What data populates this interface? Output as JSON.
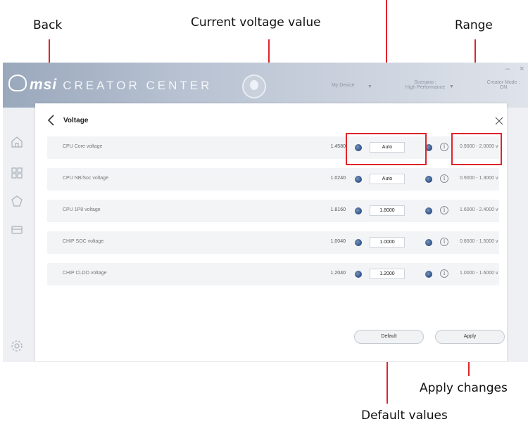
{
  "annotations": {
    "back": "Back",
    "current_voltage": "Current voltage value",
    "range": "Range",
    "apply_changes": "Apply changes",
    "default_values": "Default values"
  },
  "titlebar": {
    "brand": "msi",
    "product": "CREATOR CENTER",
    "my_device": "My Device",
    "scenario_label": "Scenario :",
    "scenario_value": "High Performance",
    "creator_mode_label": "Creator Mode :",
    "creator_mode_value": "ON"
  },
  "panel": {
    "title": "Voltage",
    "rows": [
      {
        "label": "CPU Core voltage",
        "current": "1.4580",
        "value": "Auto",
        "range": "0.9000 - 2.0000 v"
      },
      {
        "label": "CPU NB/Soc voltage",
        "current": "1.0240",
        "value": "Auto",
        "range": "0.9000 - 1.3000 v"
      },
      {
        "label": "CPU 1P8 voltage",
        "current": "1.8160",
        "value": "1.8000",
        "range": "1.6000 - 2.4000 v"
      },
      {
        "label": "CHIP SOC voltage",
        "current": "1.0040",
        "value": "1.0000",
        "range": "0.8500 - 1.5000 v"
      },
      {
        "label": "CHIP CLDO voltage",
        "current": "1.2040",
        "value": "1.2000",
        "range": "1.0000 - 1.6000 v"
      }
    ],
    "default_label": "Default",
    "apply_label": "Apply"
  },
  "icons": {
    "back": "chevron-left-icon",
    "close": "close-icon",
    "minus": "minus-circle-icon",
    "plus": "plus-circle-icon",
    "info": "info-icon"
  },
  "colors": {
    "annotation_red": "#e0242b",
    "stepper_blue": "#2a4f86"
  }
}
